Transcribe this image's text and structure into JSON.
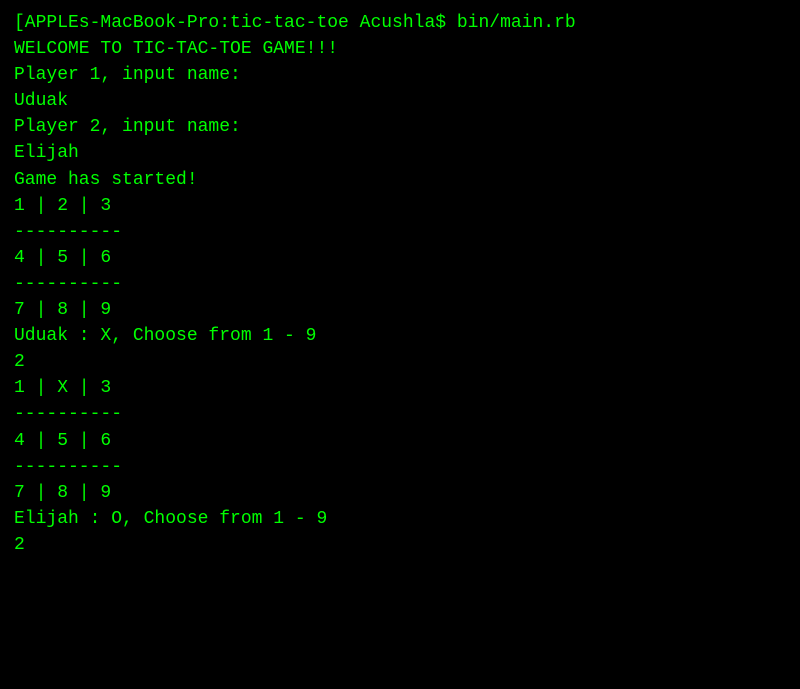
{
  "terminal": {
    "lines": [
      "[APPLEs-MacBook-Pro:tic-tac-toe Acushla$ bin/main.rb",
      "",
      "WELCOME TO TIC-TAC-TOE GAME!!!",
      "",
      "Player 1, input name:",
      "Uduak",
      "",
      "Player 2, input name:",
      "Elijah",
      "",
      "Game has started!",
      "1 | 2 | 3",
      "----------",
      "4 | 5 | 6",
      "----------",
      "7 | 8 | 9",
      "Uduak : X, Choose from 1 - 9",
      "2",
      "1 | X | 3",
      "----------",
      "4 | 5 | 6",
      "----------",
      "7 | 8 | 9",
      "Elijah : O, Choose from 1 - 9",
      "2"
    ]
  }
}
